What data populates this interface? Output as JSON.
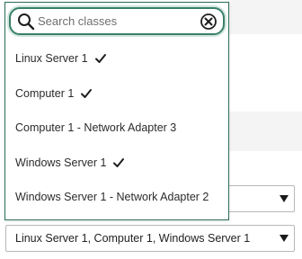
{
  "search": {
    "placeholder": "Search classes",
    "value": ""
  },
  "options": [
    {
      "label": "Linux Server 1",
      "checked": true
    },
    {
      "label": "Computer 1",
      "checked": true
    },
    {
      "label": "Computer 1 - Network Adapter 3",
      "checked": false
    },
    {
      "label": "Windows Server 1",
      "checked": true
    },
    {
      "label": "Windows Server 1 - Network Adapter 2",
      "checked": false
    }
  ],
  "select_upper": {
    "value": ""
  },
  "select_lower": {
    "value": "Linux Server 1, Computer 1, Windows Server 1"
  },
  "colors": {
    "accent": "#3a7f6b",
    "focus_ring": "#cfe6de",
    "border": "#b8b8b8"
  },
  "icons": {
    "search": "search-icon",
    "clear": "close-circle-icon",
    "check": "check-icon",
    "dropdown_arrow": "caret-down-icon"
  }
}
